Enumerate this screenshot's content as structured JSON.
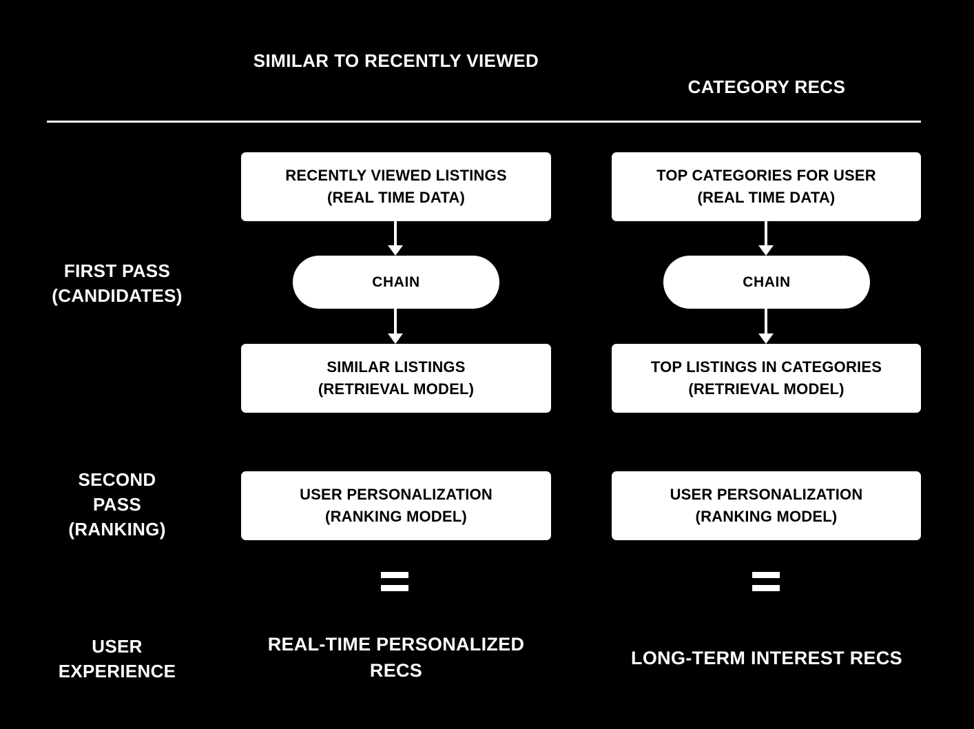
{
  "diagram": {
    "background_color": "#000000",
    "foreground_color": "#ffffff",
    "box_fill_color": "#ffffff",
    "box_text_color": "#000000"
  },
  "columns": [
    {
      "id": "similar-to-recently-viewed",
      "header": "SIMILAR TO RECENTLY\nVIEWED"
    },
    {
      "id": "category-recs",
      "header": "CATEGORY RECS"
    }
  ],
  "stages": [
    {
      "id": "first-pass",
      "label": "FIRST PASS\n(CANDIDATES)"
    },
    {
      "id": "second-pass",
      "label": "SECOND\nPASS\n(RANKING)"
    },
    {
      "id": "user-experience",
      "label": "USER\nEXPERIENCE"
    }
  ],
  "nodes": {
    "source_1": "RECENTLY VIEWED LISTINGS\n(REAL TIME DATA)",
    "source_2": "TOP CATEGORIES FOR USER\n(REAL TIME DATA)",
    "chain_1": "CHAIN",
    "chain_2": "CHAIN",
    "retrieval_1": "SIMILAR LISTINGS\n(RETRIEVAL MODEL)",
    "retrieval_2": "TOP LISTINGS IN CATEGORIES\n(RETRIEVAL MODEL)",
    "ranking_1": "USER PERSONALIZATION\n(RANKING MODEL)",
    "ranking_2": "USER PERSONALIZATION\n(RANKING MODEL)"
  },
  "operators": {
    "equals_1": "=",
    "equals_2": "="
  },
  "outcomes": {
    "outcome_1": "REAL-TIME PERSONALIZED\nRECS",
    "outcome_2": "LONG-TERM INTEREST RECS"
  }
}
